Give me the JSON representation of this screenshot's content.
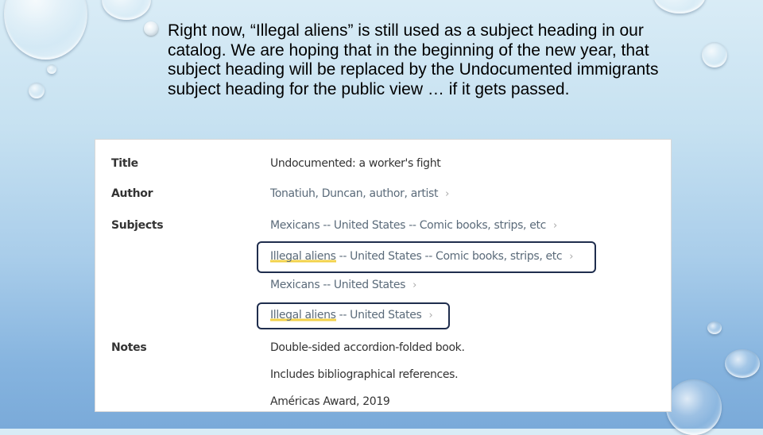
{
  "slide": {
    "bullet_text": "Right now, “Illegal aliens” is still used as a subject heading in our catalog. We are hoping that in the beginning of the new year, that subject heading will be replaced by the Undocumented immigrants subject heading for the public view …  if it gets passed."
  },
  "record": {
    "title_label": "Title",
    "title_value": "Undocumented: a worker's fight",
    "author_label": "Author",
    "author_value": "Tonatiuh, Duncan, author, artist",
    "subjects_label": "Subjects",
    "subjects": [
      {
        "highlight": "",
        "text": "Mexicans -- United States -- Comic books, strips, etc"
      },
      {
        "highlight": "Illegal aliens",
        "text": " -- United States -- Comic books, strips, etc"
      },
      {
        "highlight": "",
        "text": "Mexicans -- United States"
      },
      {
        "highlight": "Illegal aliens",
        "text": " -- United States"
      }
    ],
    "notes_label": "Notes",
    "notes": [
      "Double-sided accordion-folded book.",
      "Includes bibliographical references.",
      "Américas Award, 2019"
    ],
    "chevron": "›"
  },
  "colors": {
    "highlight": "#f2d24b",
    "callout_border": "#1f2d4d",
    "link_text": "#5b6b7a"
  }
}
